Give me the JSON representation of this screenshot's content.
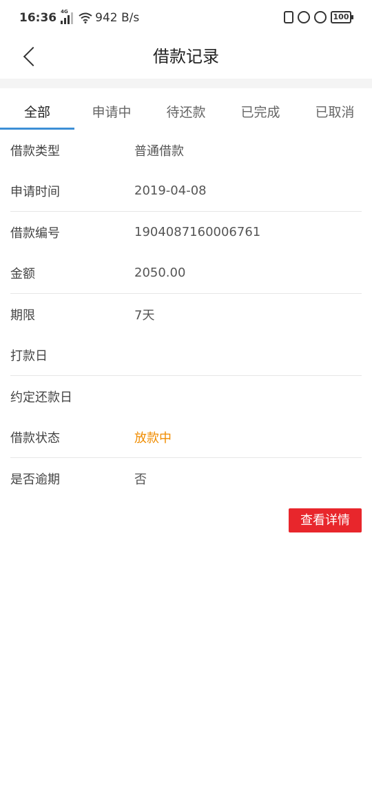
{
  "status": {
    "time": "16:36",
    "network_type": "4G",
    "speed": "942 B/s",
    "battery": "100"
  },
  "nav": {
    "title": "借款记录"
  },
  "tabs": [
    {
      "label": "全部",
      "active": true
    },
    {
      "label": "申请中",
      "active": false
    },
    {
      "label": "待还款",
      "active": false
    },
    {
      "label": "已完成",
      "active": false
    },
    {
      "label": "已取消",
      "active": false
    }
  ],
  "record": {
    "rows": [
      {
        "key": "借款类型",
        "value": "普通借款"
      },
      {
        "key": "申请时间",
        "value": "2019-04-08"
      },
      {
        "key": "借款编号",
        "value": "1904087160006761"
      },
      {
        "key": "金额",
        "value": "2050.00"
      },
      {
        "key": "期限",
        "value": "7天"
      },
      {
        "key": "打款日",
        "value": ""
      },
      {
        "key": "约定还款日",
        "value": ""
      },
      {
        "key": "借款状态",
        "value": "放款中"
      },
      {
        "key": "是否逾期",
        "value": "否"
      }
    ],
    "status_color": "#f08c00"
  },
  "actions": {
    "detail_label": "查看详情",
    "detail_color": "#e8262c"
  }
}
